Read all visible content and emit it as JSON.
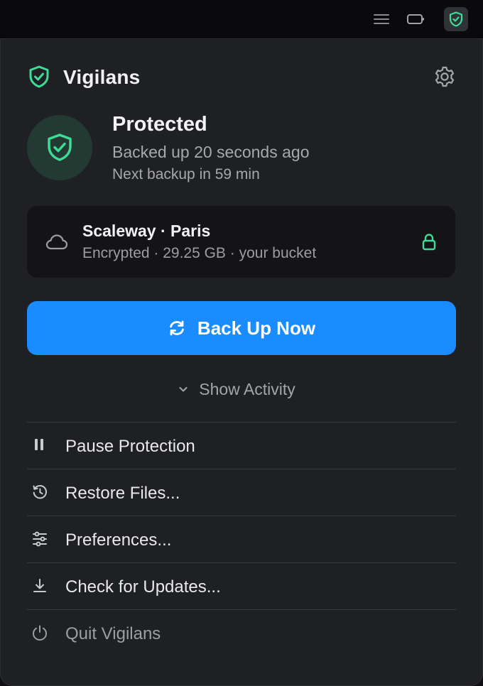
{
  "menubar": {
    "icons": [
      "menu-lines-icon",
      "battery-icon",
      "shield-check-icon"
    ]
  },
  "app": {
    "name": "Vigilans"
  },
  "status": {
    "title": "Protected",
    "last_backup": "Backed up 20 seconds ago",
    "next_backup": "Next backup in 59 min"
  },
  "storage": {
    "title": "Scaleway · Paris",
    "details": "Encrypted · 29.25 GB · your bucket"
  },
  "actions": {
    "backup_label": "Back Up Now",
    "activity_label": "Show Activity"
  },
  "menu": {
    "items": [
      {
        "label": "Pause Protection",
        "icon": "pause-icon"
      },
      {
        "label": "Restore Files...",
        "icon": "clock-history-icon"
      },
      {
        "label": "Preferences...",
        "icon": "sliders-icon"
      },
      {
        "label": "Check for Updates...",
        "icon": "download-icon"
      },
      {
        "label": "Quit Vigilans",
        "icon": "power-icon"
      }
    ]
  },
  "colors": {
    "accent": "#1a8cff",
    "protected": "#3ddc97",
    "panel_bg": "#1f2023",
    "card_bg": "#141416"
  }
}
